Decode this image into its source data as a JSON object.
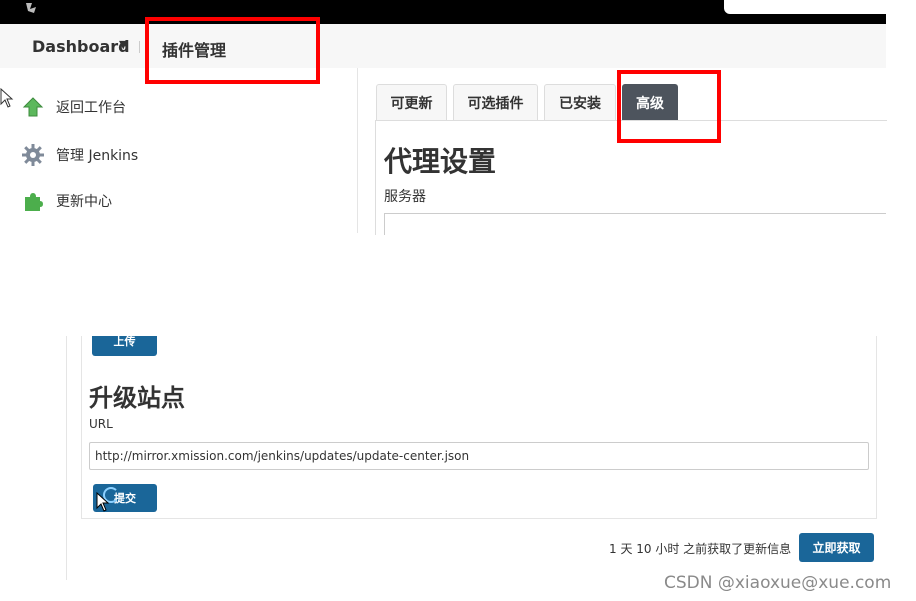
{
  "breadcrumb": {
    "dashboard": "Dashboard",
    "current": "插件管理"
  },
  "sidebar": {
    "items": [
      {
        "label": "返回工作台",
        "icon": "arrow-up-icon"
      },
      {
        "label": "管理 Jenkins",
        "icon": "gear-icon"
      },
      {
        "label": "更新中心",
        "icon": "puzzle-icon"
      }
    ]
  },
  "tabs": [
    {
      "label": "可更新",
      "active": false
    },
    {
      "label": "可选插件",
      "active": false
    },
    {
      "label": "已安装",
      "active": false
    },
    {
      "label": "高级",
      "active": true
    }
  ],
  "proxy": {
    "title": "代理设置",
    "server_label": "服务器",
    "server_value": ""
  },
  "upload": {
    "button_label": "上传"
  },
  "update_site": {
    "title": "升级站点",
    "url_label": "URL",
    "url_value": "http://mirror.xmission.com/jenkins/updates/update-center.json",
    "submit_label": "提交"
  },
  "footer": {
    "update_info": "1 天 10 小时 之前获取了更新信息",
    "fetch_label": "立即获取"
  },
  "watermark": "CSDN @xiaoxue@xue.com",
  "colors": {
    "accent_button": "#1a6699",
    "active_tab": "#4d545d",
    "highlight": "#ff0000"
  }
}
